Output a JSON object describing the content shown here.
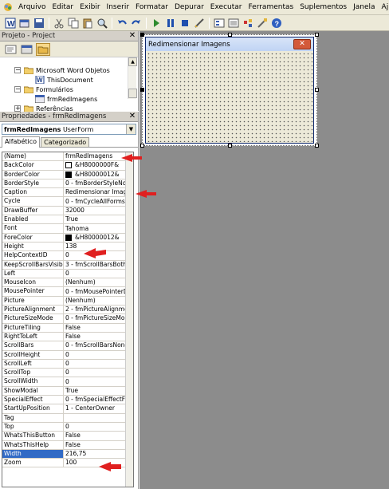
{
  "menubar": {
    "items": [
      {
        "label": "Arquivo",
        "key": "A",
        "rest": "rquivo"
      },
      {
        "label": "Editar",
        "key": "E",
        "rest": "ditar"
      },
      {
        "label": "Exibir",
        "key": "x",
        "pre": "E",
        "rest": "ibir"
      },
      {
        "label": "Inserir",
        "key": "I",
        "rest": "nserir"
      },
      {
        "label": "Formatar",
        "key": "o",
        "pre": "F",
        "rest": "rmatar"
      },
      {
        "label": "Depurar",
        "key": "D",
        "rest": "epurar"
      },
      {
        "label": "Executar",
        "key": "E",
        "rest": "xecutar"
      },
      {
        "label": "Ferramentas",
        "key": "F",
        "rest": "erramentas"
      },
      {
        "label": "Suplementos",
        "key": "S",
        "rest": "uplementos"
      },
      {
        "label": "Janela",
        "key": "J",
        "rest": "anela"
      },
      {
        "label": "Ajuda",
        "key": "A",
        "rest": "juda"
      }
    ]
  },
  "project": {
    "title": "Projeto - Project",
    "tree": [
      {
        "label": "Microsoft Word Objetos",
        "icon": "folder-icon"
      },
      {
        "label": "ThisDocument",
        "icon": "word-document-icon"
      },
      {
        "label": "Formulários",
        "icon": "folder-icon"
      },
      {
        "label": "frmRedImagens",
        "icon": "userform-icon"
      },
      {
        "label": "Referências",
        "icon": "folder-icon"
      }
    ]
  },
  "properties": {
    "title": "Propriedades - frmRedImagens",
    "object_name": "frmRedImagens",
    "object_type": "UserForm",
    "tabs": [
      "Alfabético",
      "Categorizado"
    ],
    "rows": [
      {
        "name": "(Name)",
        "value": "frmRedImagens"
      },
      {
        "name": "BackColor",
        "value": "&H8000000F&",
        "swatch": "#ffffff"
      },
      {
        "name": "BorderColor",
        "value": "&H80000012&",
        "swatch": "#000000"
      },
      {
        "name": "BorderStyle",
        "value": "0 - fmBorderStyleNone"
      },
      {
        "name": "Caption",
        "value": "Redimensionar Imagens"
      },
      {
        "name": "Cycle",
        "value": "0 - fmCycleAllForms"
      },
      {
        "name": "DrawBuffer",
        "value": "32000"
      },
      {
        "name": "Enabled",
        "value": "True"
      },
      {
        "name": "Font",
        "value": "Tahoma"
      },
      {
        "name": "ForeColor",
        "value": "&H80000012&",
        "swatch": "#000000"
      },
      {
        "name": "Height",
        "value": "138"
      },
      {
        "name": "HelpContextID",
        "value": "0"
      },
      {
        "name": "KeepScrollBarsVisible",
        "value": "3 - fmScrollBarsBoth"
      },
      {
        "name": "Left",
        "value": "0"
      },
      {
        "name": "MouseIcon",
        "value": "(Nenhum)"
      },
      {
        "name": "MousePointer",
        "value": "0 - fmMousePointerDefa"
      },
      {
        "name": "Picture",
        "value": "(Nenhum)"
      },
      {
        "name": "PictureAlignment",
        "value": "2 - fmPictureAlignmentC"
      },
      {
        "name": "PictureSizeMode",
        "value": "0 - fmPictureSizeModeCl"
      },
      {
        "name": "PictureTiling",
        "value": "False"
      },
      {
        "name": "RightToLeft",
        "value": "False"
      },
      {
        "name": "ScrollBars",
        "value": "0 - fmScrollBarsNone"
      },
      {
        "name": "ScrollHeight",
        "value": "0"
      },
      {
        "name": "ScrollLeft",
        "value": "0"
      },
      {
        "name": "ScrollTop",
        "value": "0"
      },
      {
        "name": "ScrollWidth",
        "value": "0"
      },
      {
        "name": "ShowModal",
        "value": "True"
      },
      {
        "name": "SpecialEffect",
        "value": "0 - fmSpecialEffectFlat"
      },
      {
        "name": "StartUpPosition",
        "value": "1 - CenterOwner"
      },
      {
        "name": "Tag",
        "value": ""
      },
      {
        "name": "Top",
        "value": "0"
      },
      {
        "name": "WhatsThisButton",
        "value": "False"
      },
      {
        "name": "WhatsThisHelp",
        "value": "False"
      },
      {
        "name": "Width",
        "value": "216,75"
      },
      {
        "name": "Zoom",
        "value": "100"
      }
    ]
  },
  "userform": {
    "caption": "Redimensionar Imagens"
  },
  "colors": {
    "accent": "#316ac5",
    "arrow": "#e02020",
    "workspace": "#8c8c8c"
  }
}
